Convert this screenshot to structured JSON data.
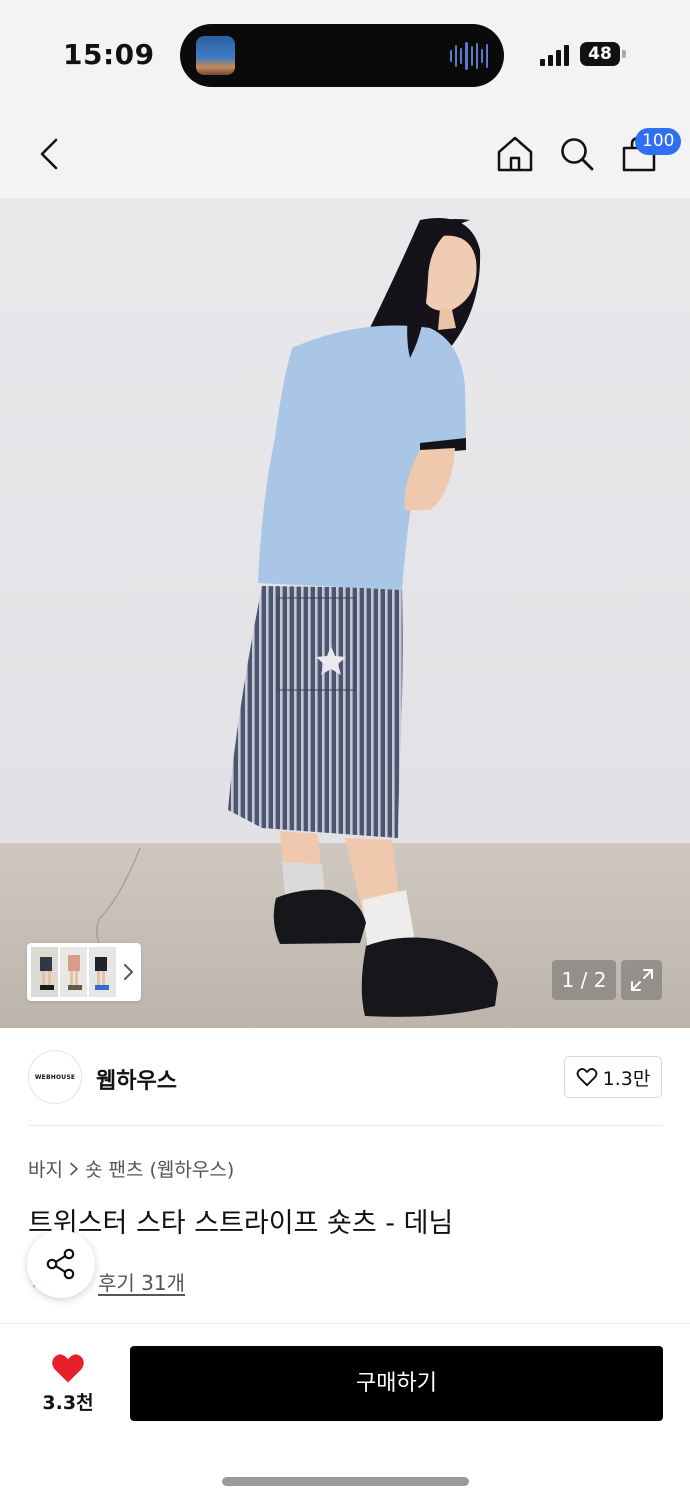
{
  "status_bar": {
    "time": "15:09",
    "battery": "48",
    "icons": [
      "now-playing-artwork",
      "audio-waveform-icon",
      "cellular-signal-icon",
      "battery-icon"
    ]
  },
  "header": {
    "back_icon": "chevron-left-icon",
    "home_icon": "home-icon",
    "search_icon": "search-icon",
    "cart_icon": "shopping-bag-icon",
    "cart_count": "100",
    "badge_color": "#2f6ff1"
  },
  "gallery": {
    "page_counter": "1 / 2",
    "expand_icon": "expand-icon",
    "thumb_chevron": "chevron-right-icon"
  },
  "brand": {
    "logo_text": "WEBHOUSE",
    "name": "웹하우스",
    "like_count": "1.3만",
    "like_icon": "heart-outline-icon"
  },
  "product": {
    "breadcrumb": [
      "바지",
      "숏 팬츠 (웹하우스)"
    ],
    "title": "트위스터 스타 스트라이프 숏츠 - 데님",
    "review_link": "후기 31개",
    "share_icon": "share-icon",
    "rating_icon": "star-icon"
  },
  "bottom_bar": {
    "like_icon": "heart-filled-icon",
    "like_color": "#e8202a",
    "like_count": "3.3천",
    "buy_label": "구매하기"
  }
}
